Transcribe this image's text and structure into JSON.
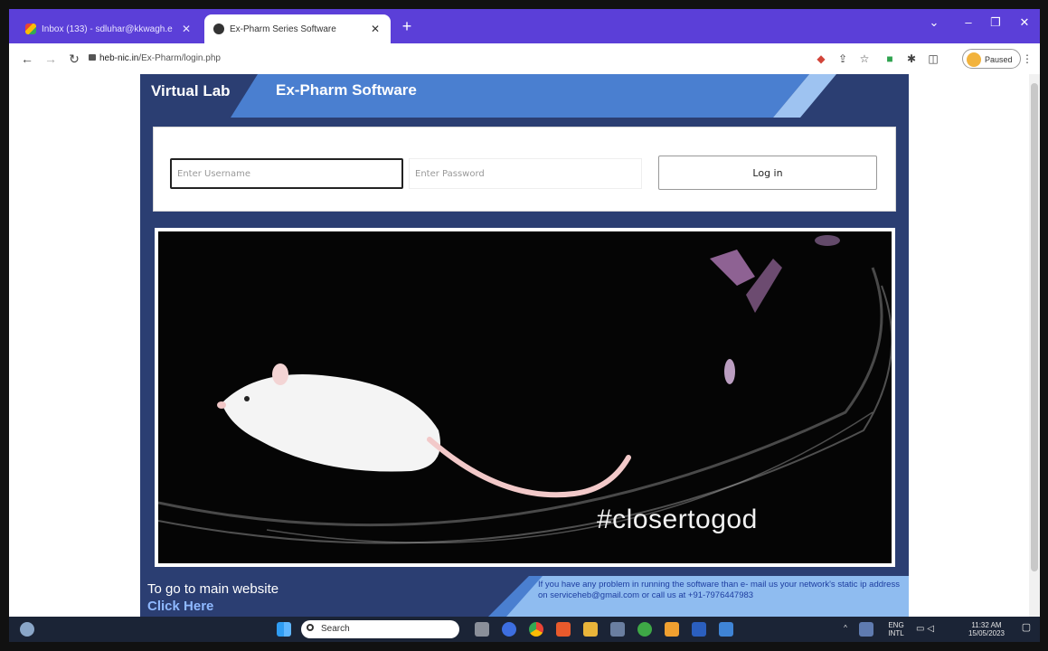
{
  "browser": {
    "tabs": [
      {
        "label": "Inbox (133) - sdluhar@kkwagh.e",
        "state": "inactive",
        "favicon": "gmail-icon"
      },
      {
        "label": "Ex-Pharm Series Software",
        "state": "active",
        "favicon": "site-icon"
      }
    ],
    "address": {
      "host": "heb-nic.in",
      "path": "/Ex-Pharm/login.php"
    },
    "profile_status": "Paused"
  },
  "site": {
    "brand": "Virtual Lab",
    "app_title": "Ex-Pharm Software",
    "login": {
      "username_placeholder": "Enter Username",
      "password_placeholder": "Enter Password",
      "submit_label": "Log in"
    },
    "hero": {
      "hashtag": "#closertogod"
    },
    "footer": {
      "main_site_text": "To go to main website",
      "main_site_link": "Click Here",
      "support_text": "If you have any problem in running the software than e- mail us your network's static ip address on serviceheb@gmail.com or call us at +91-7976447983"
    },
    "colors": {
      "brand_navy": "#2b3e72",
      "brand_blue": "#4a7fd0",
      "accent_light": "#9ec3f1"
    }
  },
  "taskbar": {
    "search_label": "Search",
    "language": "ENG",
    "language_sub": "INTL",
    "time": "11:32 AM",
    "date": "15/05/2023"
  }
}
